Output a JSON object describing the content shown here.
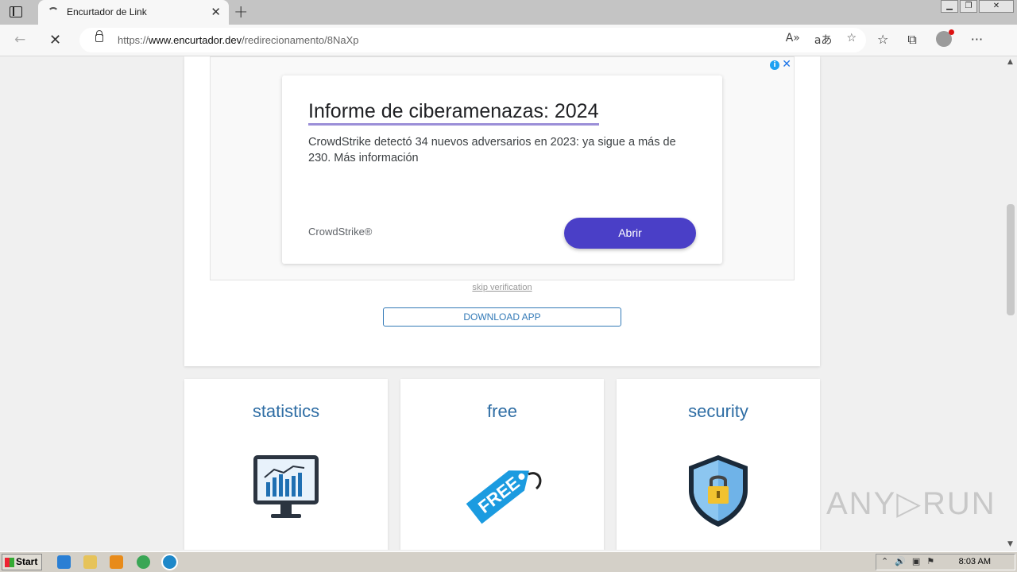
{
  "browser": {
    "tab_title": "Encurtador de Link",
    "url_prefix": "https://",
    "url_host": "www.encurtador.dev",
    "url_path": "/redirecionamento/8NaXp"
  },
  "ad": {
    "title": "Informe de ciberamenazas: 2024",
    "body": "CrowdStrike detectó 34 nuevos adversarios en 2023: ya sigue a más de 230. Más información",
    "brand": "CrowdStrike®",
    "button_label": "Abrir",
    "info_glyph": "i",
    "close_glyph": "✕"
  },
  "page": {
    "skip_label": "skip verification",
    "download_label": "DOWNLOAD APP"
  },
  "features": [
    {
      "title": "statistics",
      "icon": "monitor-chart-icon"
    },
    {
      "title": "free",
      "icon": "free-tag-icon",
      "tag_text": "FREE"
    },
    {
      "title": "security",
      "icon": "shield-lock-icon"
    }
  ],
  "watermark": "ANY▷RUN",
  "taskbar": {
    "start_label": "Start",
    "clock": "8:03 AM"
  },
  "colors": {
    "ad_button": "#4a3fc7",
    "feature_title": "#2e6da4",
    "download_border": "#337ab7"
  }
}
